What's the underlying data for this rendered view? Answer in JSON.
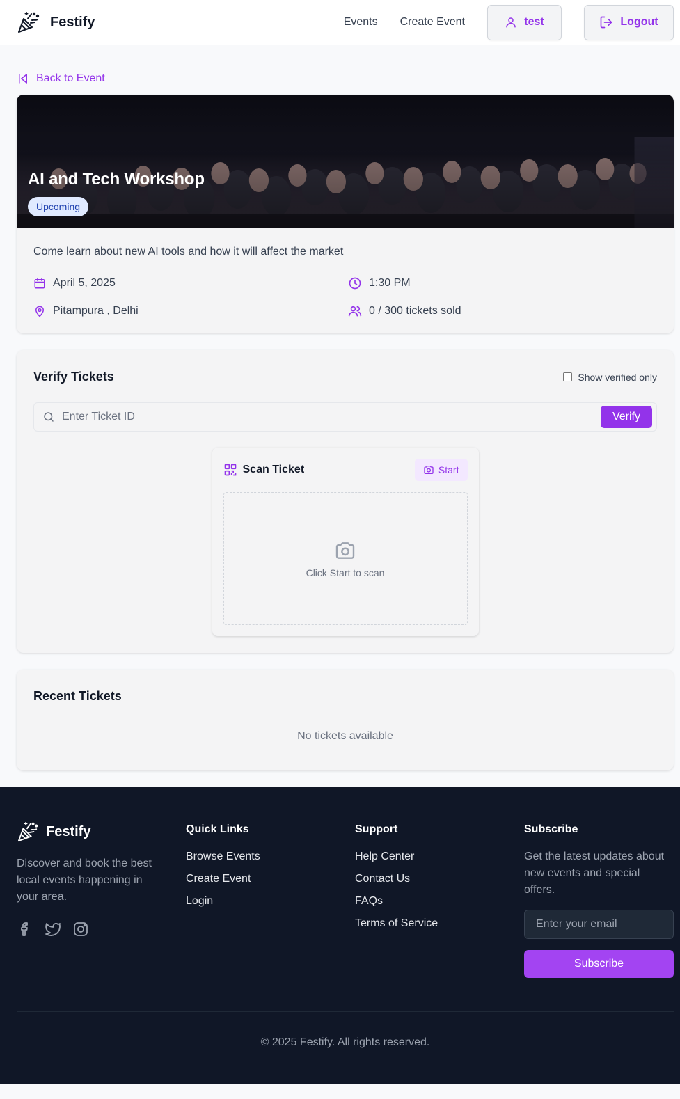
{
  "colors": {
    "accent": "#9333ea",
    "footer_bg": "#101727",
    "badge_bg": "#e0eaff",
    "badge_text": "#1e40af"
  },
  "header": {
    "brand": "Festify",
    "nav": [
      {
        "label": "Events"
      },
      {
        "label": "Create Event"
      }
    ],
    "user_label": "test",
    "logout_label": "Logout"
  },
  "back_link": "Back to Event",
  "event": {
    "title": "AI and Tech Workshop",
    "status": "Upcoming",
    "description": "Come learn about new AI tools and how it will affect the market",
    "date": "April 5, 2025",
    "time": "1:30 PM",
    "location": "Pitampura , Delhi",
    "tickets": "0 / 300 tickets sold"
  },
  "verify": {
    "title": "Verify Tickets",
    "verified_only_label": "Show verified only",
    "input_placeholder": "Enter Ticket ID",
    "verify_label": "Verify",
    "scan": {
      "title": "Scan Ticket",
      "start_label": "Start",
      "hint": "Click Start to scan"
    }
  },
  "recent": {
    "title": "Recent Tickets",
    "empty": "No tickets available"
  },
  "footer": {
    "brand": "Festify",
    "description": "Discover and book the best local events happening in your area.",
    "quick_links": {
      "title": "Quick Links",
      "items": [
        "Browse Events",
        "Create Event",
        "Login"
      ]
    },
    "support": {
      "title": "Support",
      "items": [
        "Help Center",
        "Contact Us",
        "FAQs",
        "Terms of Service"
      ]
    },
    "subscribe": {
      "title": "Subscribe",
      "description": "Get the latest updates about new events and special offers.",
      "email_placeholder": "Enter your email",
      "button_label": "Subscribe"
    },
    "copyright": "© 2025 Festify. All rights reserved."
  }
}
